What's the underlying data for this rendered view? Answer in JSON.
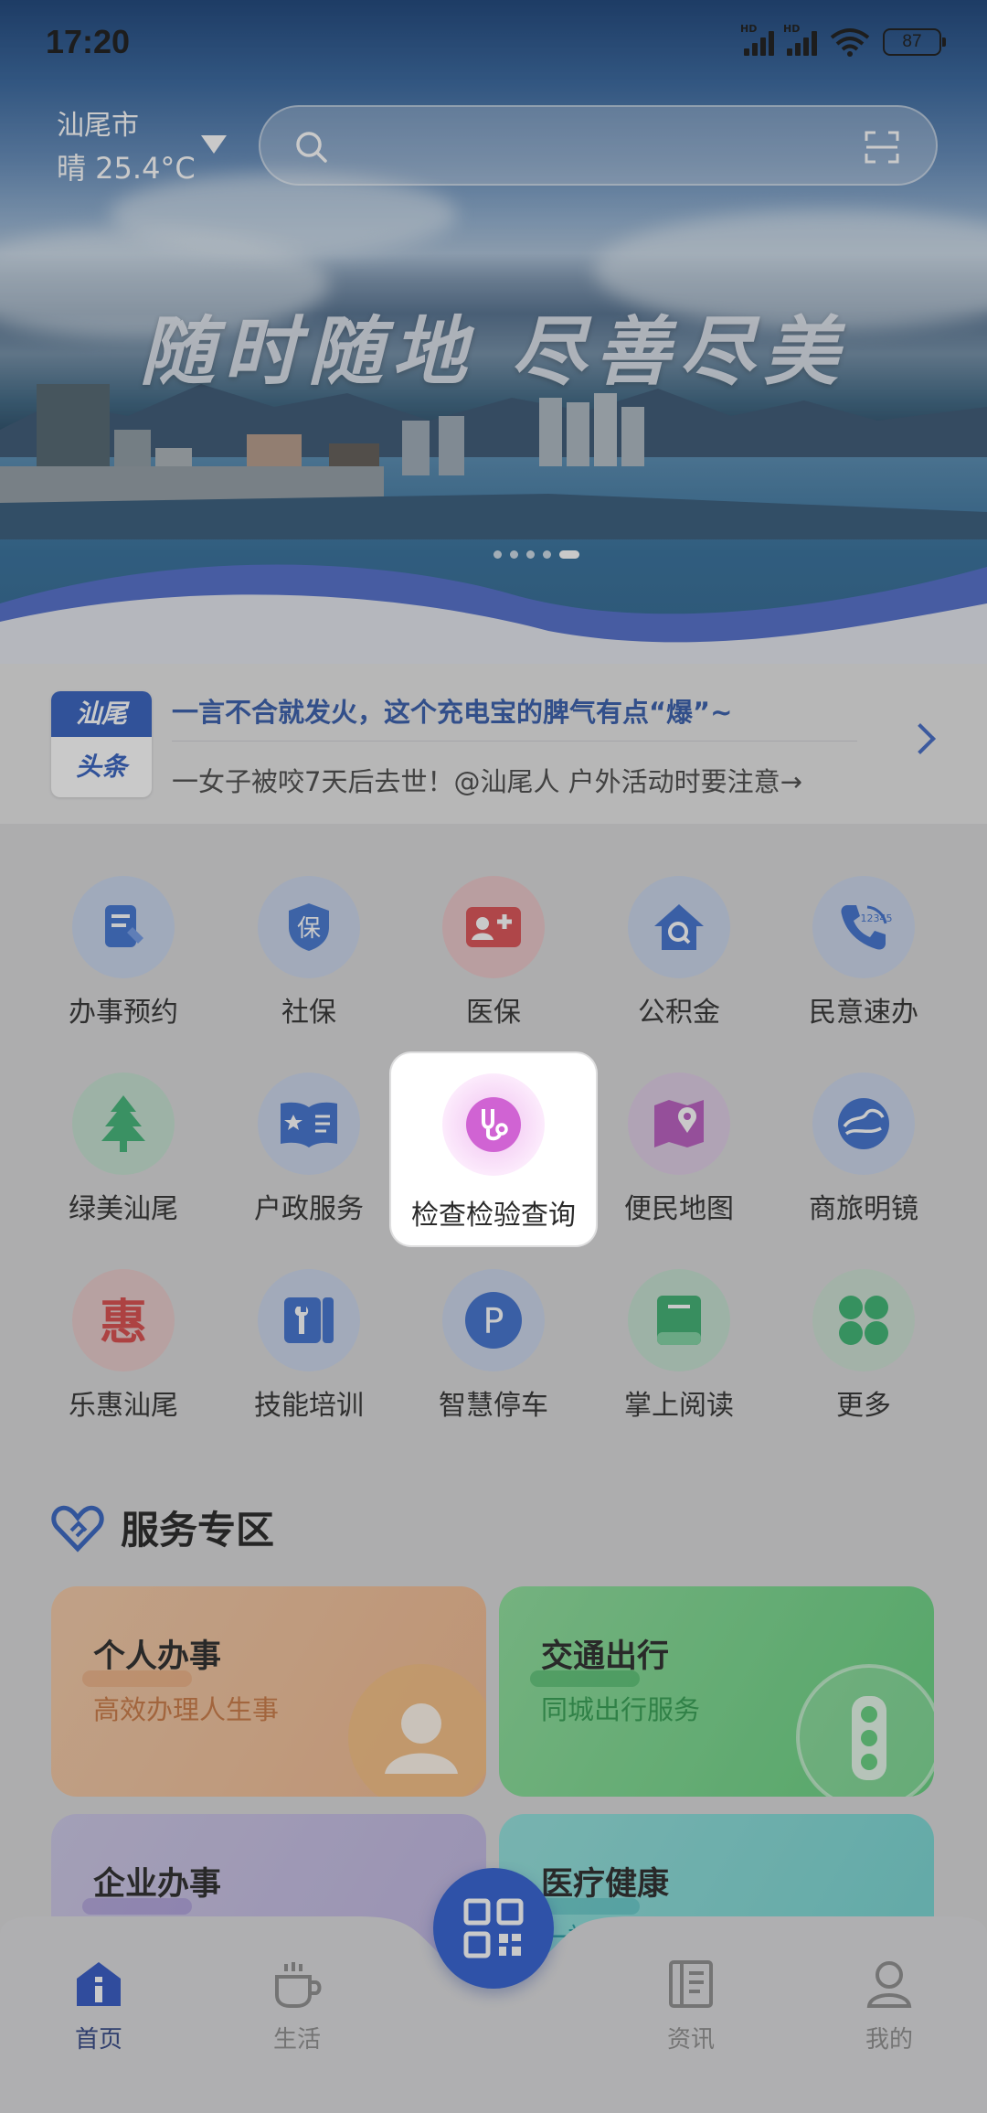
{
  "status_bar": {
    "time": "17:20",
    "net1": "HD",
    "net2": "HD",
    "battery": "87"
  },
  "location": {
    "city": "汕尾市",
    "weather": "晴 25.4°C"
  },
  "search": {
    "placeholder": ""
  },
  "banner": {
    "slogan": "随时随地 尽善尽美",
    "slides": 5,
    "active_slide": 5
  },
  "news": {
    "logo_top": "汕尾",
    "logo_bottom": "头条",
    "headline": "一言不合就发火，这个充电宝的脾气有点“爆”~",
    "subline": "一女子被咬7天后去世！@汕尾人 户外活动时要注意→"
  },
  "services": [
    {
      "label": "办事预约",
      "icon": "form-pen-icon"
    },
    {
      "label": "社保",
      "icon": "shield-bao-icon"
    },
    {
      "label": "医保",
      "icon": "medical-card-icon"
    },
    {
      "label": "公积金",
      "icon": "house-search-icon"
    },
    {
      "label": "民意速办",
      "icon": "phone-12345-icon"
    },
    {
      "label": "绿美汕尾",
      "icon": "tree-icon"
    },
    {
      "label": "户政服务",
      "icon": "id-book-icon"
    },
    {
      "label": "检查检验查询",
      "icon": "stethoscope-icon"
    },
    {
      "label": "便民地图",
      "icon": "map-pin-icon"
    },
    {
      "label": "商旅明镜",
      "icon": "globe-icon"
    },
    {
      "label": "乐惠汕尾",
      "icon": "hui-icon"
    },
    {
      "label": "技能培训",
      "icon": "wrench-book-icon"
    },
    {
      "label": "智慧停车",
      "icon": "parking-icon"
    },
    {
      "label": "掌上阅读",
      "icon": "book-icon"
    },
    {
      "label": "更多",
      "icon": "clover-icon"
    }
  ],
  "service_zone": {
    "title": "服务专区",
    "cards": [
      {
        "title": "个人办事",
        "subtitle": "高效办理人生事"
      },
      {
        "title": "交通出行",
        "subtitle": "同城出行服务"
      },
      {
        "title": "企业办事",
        "subtitle": ""
      },
      {
        "title": "医疗健康",
        "subtitle": "一站式"
      }
    ]
  },
  "nav": {
    "home": "首页",
    "life": "生活",
    "news": "资讯",
    "mine": "我的"
  },
  "colors": {
    "accent": "#2a5bd2",
    "brand_blue": "#2d5bbd",
    "green_card": "#63d07c",
    "orange_card": "#f3b47f"
  }
}
